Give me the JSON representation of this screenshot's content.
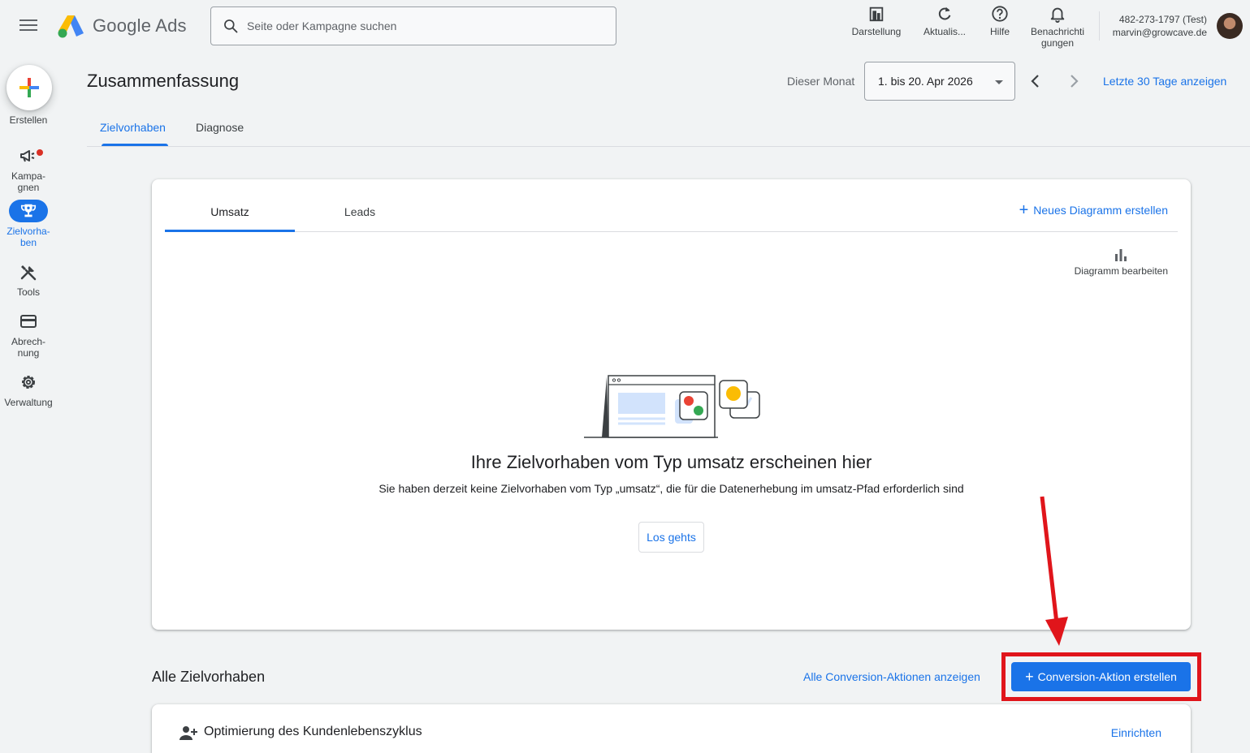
{
  "app": {
    "name": "Google Ads"
  },
  "search": {
    "placeholder": "Seite oder Kampagne suchen"
  },
  "top_actions": {
    "darstellung": "Darstellung",
    "aktualisieren": "Aktualis...",
    "hilfe": "Hilfe",
    "benachrichtigungen_1": "Benachrichti",
    "benachrichtigungen_2": "gungen"
  },
  "account": {
    "id": "482-273-1797 (Test)",
    "email": "marvin@growcave.de"
  },
  "sidenav": {
    "create": "Erstellen",
    "kampagnen_1": "Kampa-",
    "kampagnen_2": "gnen",
    "zielvorhaben_1": "Zielvorha-",
    "zielvorhaben_2": "ben",
    "tools": "Tools",
    "abrechnung_1": "Abrech-",
    "abrechnung_2": "nung",
    "verwaltung": "Verwaltung"
  },
  "header": {
    "title": "Zusammenfassung",
    "date_label": "Dieser Monat",
    "date_value": "1. bis 20. Apr 2026",
    "last30_link": "Letzte 30 Tage anzeigen"
  },
  "tabs": [
    {
      "label": "Zielvorhaben"
    },
    {
      "label": "Diagnose"
    }
  ],
  "card": {
    "tabs": [
      {
        "label": "Umsatz"
      },
      {
        "label": "Leads"
      }
    ],
    "new_chart": "Neues Diagramm erstellen",
    "edit_chart": "Diagramm bearbeiten",
    "empty_title": "Ihre Zielvorhaben vom Typ umsatz erscheinen hier",
    "empty_sub": "Sie haben derzeit keine Zielvorhaben vom Typ „umsatz“, die für die Datenerhebung im umsatz-Pfad erforderlich sind",
    "start_button": "Los gehts"
  },
  "all_goals": {
    "title": "Alle Zielvorhaben",
    "show_all_link": "Alle Conversion-Aktionen anzeigen",
    "create_button": "Conversion-Aktion erstellen"
  },
  "lifecycle": {
    "title": "Optimierung des Kundenlebenszyklus",
    "setup_link": "Einrichten"
  },
  "colors": {
    "accent": "#1a73e8",
    "annotation_red": "#e0151b",
    "background": "#f1f3f4"
  }
}
